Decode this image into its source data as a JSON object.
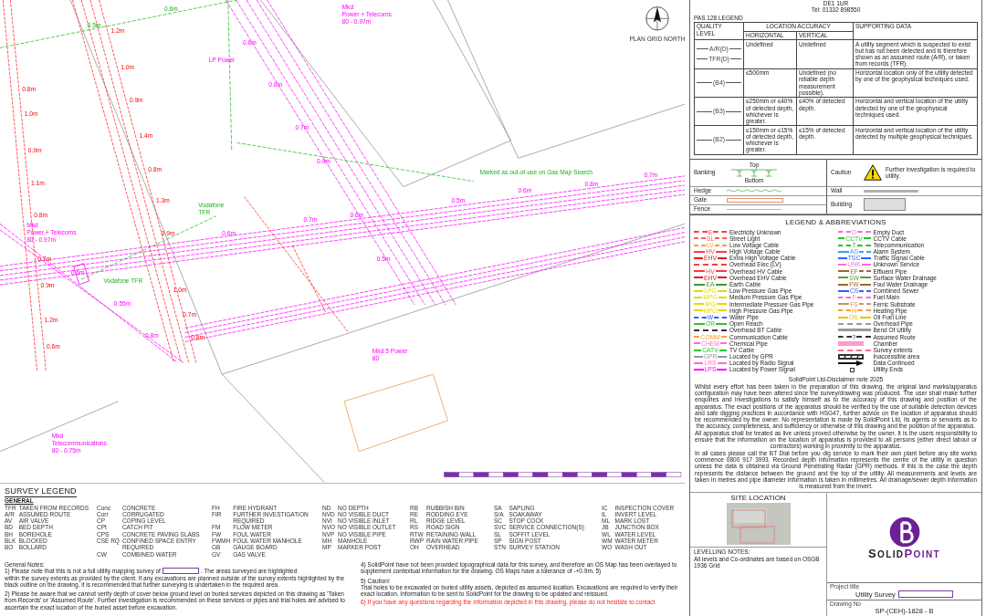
{
  "header": {
    "address_lines": [
      "DE1 1UR",
      "Tel: 01332 898550"
    ]
  },
  "map": {
    "north_label": "PLAN GRID NORTH",
    "notes": [
      {
        "lines": [
          "Mkd",
          "Power + Telecoms",
          "80 - 0.97m"
        ],
        "kind": "signal"
      },
      {
        "lines": [
          "LP Power"
        ],
        "kind": "signal"
      },
      {
        "lines": [
          "Mkd",
          "Power + Telecoms",
          "80 - 0.97m"
        ],
        "kind": "signal"
      },
      {
        "lines": [
          "Vodafone TFR"
        ],
        "kind": "records"
      },
      {
        "lines": [
          "Vodafone",
          "TFR"
        ],
        "kind": "records"
      },
      {
        "lines": [
          "Marked as out-of-use on Gas Map Search"
        ],
        "kind": "records"
      },
      {
        "lines": [
          "Mkd 5 Power",
          "80"
        ],
        "kind": "signal"
      },
      {
        "lines": [
          "Mkd",
          "Telecommunications",
          "80 - 0.75m"
        ],
        "kind": "signal"
      }
    ],
    "depths": [
      {
        "text": "0.8m",
        "kind": "electric"
      },
      {
        "text": "1.0m",
        "kind": "electric"
      },
      {
        "text": "0.9m",
        "kind": "electric"
      },
      {
        "text": "1.1m",
        "kind": "electric"
      },
      {
        "text": "0.8m",
        "kind": "electric"
      },
      {
        "text": "0.7m",
        "kind": "electric"
      },
      {
        "text": "0.9m",
        "kind": "electric"
      },
      {
        "text": "1.2m",
        "kind": "electric"
      },
      {
        "text": "0.6m",
        "kind": "electric"
      },
      {
        "text": "1.2m",
        "kind": "electric"
      },
      {
        "text": "1.0m",
        "kind": "electric"
      },
      {
        "text": "0.9m",
        "kind": "electric"
      },
      {
        "text": "1.4m",
        "kind": "electric"
      },
      {
        "text": "0.8m",
        "kind": "electric"
      },
      {
        "text": "1.3m",
        "kind": "electric"
      },
      {
        "text": "0.9m",
        "kind": "electric"
      },
      {
        "text": "1.0m",
        "kind": "electric"
      },
      {
        "text": "0.7m",
        "kind": "electric"
      },
      {
        "text": "0.8m",
        "kind": "electric"
      },
      {
        "text": "0.6m",
        "kind": "signal"
      },
      {
        "text": "0.8m",
        "kind": "signal"
      },
      {
        "text": "0.7m",
        "kind": "signal"
      },
      {
        "text": "0.9m",
        "kind": "signal"
      },
      {
        "text": "0.6m",
        "kind": "signal"
      },
      {
        "text": "0.5m",
        "kind": "signal"
      },
      {
        "text": "0.6m",
        "kind": "signal"
      },
      {
        "text": "0.7m",
        "kind": "signal"
      },
      {
        "text": "0.5m",
        "kind": "signal"
      },
      {
        "text": "0.6m",
        "kind": "signal"
      },
      {
        "text": "0.8m",
        "kind": "signal"
      },
      {
        "text": "0.7m",
        "kind": "signal"
      },
      {
        "text": "0.6m",
        "kind": "signal"
      },
      {
        "text": "0.55m",
        "kind": "signal"
      },
      {
        "text": "0.8m",
        "kind": "signal"
      },
      {
        "text": "0.5m",
        "kind": "records"
      },
      {
        "text": "0.6m",
        "kind": "records"
      }
    ]
  },
  "pas128": {
    "title": "PAS 128 LEGEND",
    "headers": {
      "quality": "QUALITY LEVEL",
      "accuracy": "LOCATION ACCURACY",
      "horizontal": "HORIZONTAL",
      "vertical": "VERTICAL",
      "supporting": "SUPPORTING DATA"
    },
    "rows": [
      {
        "codes": [
          "A/R(D)",
          "TFR(D)"
        ],
        "horizontal": "Undefined",
        "vertical": "Undefined",
        "supporting": "A utility segment which is suspected to exist but has not been detected and is therefore shown as an assumed route (A/R), or taken from records (TFR)."
      },
      {
        "codes": [
          "(B4)"
        ],
        "horizontal": "≤500mm",
        "vertical": "Undefined (no reliable depth measurement possible).",
        "supporting": "Horizontal location only of the utility detected by one of the geophysical techniques used."
      },
      {
        "codes": [
          "(B3)"
        ],
        "horizontal": "≤250mm or ≤40% of detected depth, whichever is greater.",
        "vertical": "≤40% of detected depth.",
        "supporting": "Horizontal and vertical location of the utility detected by one of the geophysical techniques used."
      },
      {
        "codes": [
          "(B2)"
        ],
        "horizontal": "≤150mm or ≤15% of detected depth, whichever is greater.",
        "vertical": "≤15% of detected depth.",
        "supporting": "Horizontal and vertical location of the utility detected by multiple geophysical techniques."
      }
    ]
  },
  "features": {
    "banking": {
      "label": "Banking",
      "top": "Top",
      "bottom": "Bottom"
    },
    "caution": {
      "label": "Caution",
      "text": "Further investigation is required to utility."
    },
    "items": [
      {
        "label": "Hedge",
        "kind": "hedge"
      },
      {
        "label": "Wall",
        "kind": "wall"
      },
      {
        "label": "Gate",
        "kind": "gate"
      },
      {
        "label": "Building",
        "kind": "building"
      },
      {
        "label": "Fence",
        "kind": "fence"
      }
    ]
  },
  "legend": {
    "title": "LEGEND & ABBREVIATIONS",
    "columns": [
      [
        {
          "code": "E",
          "label": "Electricity Unknown",
          "color": "#ff3b3b",
          "kind": "line"
        },
        {
          "code": "SL",
          "label": "Street Light",
          "color": "#ff5a5a",
          "kind": "line"
        },
        {
          "code": "LV",
          "label": "Low Voltage Cable",
          "color": "#ff9b30",
          "kind": "line"
        },
        {
          "code": "HV",
          "label": "High Voltage Cable",
          "color": "#ff3b3b",
          "kind": "line"
        },
        {
          "code": "EHV",
          "label": "Extra High Voltage Cable",
          "color": "#d81b1b",
          "kind": "line"
        },
        {
          "label": "Overhead Elec (LV)",
          "color": "#ff3b3b",
          "kind": "line"
        },
        {
          "code": "HV",
          "label": "Overhead HV Cable",
          "color": "#ff3b3b",
          "kind": "line"
        },
        {
          "code": "EHV",
          "label": "Overhead EHV Cable",
          "color": "#d81b1b",
          "kind": "line"
        },
        {
          "code": "EA",
          "label": "Earth Cable",
          "color": "#3a9a3a",
          "kind": "line"
        },
        {
          "code": "LPG",
          "label": "Low Pressure Gas Pipe",
          "color": "#e6d800",
          "kind": "line"
        },
        {
          "code": "MPG",
          "label": "Medium Pressure Gas Pipe",
          "color": "#e6d800",
          "kind": "line"
        },
        {
          "code": "IPG",
          "label": "Intermediate Pressure Gas Pipe",
          "color": "#e6d800",
          "kind": "line"
        },
        {
          "code": "HPG",
          "label": "High Pressure Gas Pipe",
          "color": "#e6d800",
          "kind": "line"
        },
        {
          "code": "W",
          "label": "Water Pipe",
          "color": "#3060ff",
          "kind": "line"
        },
        {
          "code": "OR",
          "label": "Open Reach",
          "color": "#2fbf2f",
          "kind": "line"
        },
        {
          "label": "Overhead BT Cable",
          "color": "#333333",
          "kind": "line"
        },
        {
          "code": "COMM",
          "label": "Communication Cable",
          "color": "#ff9b30",
          "kind": "line"
        },
        {
          "code": "CHEM",
          "label": "Chemical Pipe",
          "color": "#ff6ad5",
          "kind": "line"
        },
        {
          "code": "CATV",
          "label": "TV Cable",
          "color": "#2fbf2f",
          "kind": "line"
        },
        {
          "code": "GPR",
          "label": "Located by GPR",
          "color": "#9a9a9a",
          "kind": "line"
        },
        {
          "code": "LRS",
          "label": "Located by Radio Signal",
          "color": "#ff6ad5",
          "kind": "line"
        },
        {
          "code": "LPS",
          "label": "Located by Power Signal",
          "color": "#ff00ff",
          "kind": "line"
        }
      ],
      [
        {
          "code": "D",
          "label": "Empty Duct",
          "color": "#ff6ad5",
          "kind": "line"
        },
        {
          "code": "CCTV",
          "label": "CCTV Cable",
          "color": "#2fbf2f",
          "kind": "line"
        },
        {
          "code": "T",
          "label": "Telecommunication",
          "color": "#2fbf2f",
          "kind": "line"
        },
        {
          "code": "AS",
          "label": "Alarm System",
          "color": "#30a0ff",
          "kind": "line"
        },
        {
          "code": "TSC",
          "label": "Traffic Signal Cable",
          "color": "#3060ff",
          "kind": "line"
        },
        {
          "code": "UNK",
          "label": "Unknown Service",
          "color": "#ff6ad5",
          "kind": "line"
        },
        {
          "code": "EF",
          "label": "Effluent Pipe",
          "color": "#a0662a",
          "kind": "line"
        },
        {
          "code": "SW",
          "label": "Surface Water Drainage",
          "color": "#5f9f2f",
          "kind": "line"
        },
        {
          "code": "FW",
          "label": "Foul Water Drainage",
          "color": "#a0662a",
          "kind": "line"
        },
        {
          "code": "CS",
          "label": "Combined Sewer",
          "color": "#3060ff",
          "kind": "line"
        },
        {
          "code": "F",
          "label": "Fuel Main",
          "color": "#ff6ad5",
          "kind": "line"
        },
        {
          "code": "FS",
          "label": "Ferric Substrate",
          "color": "#c8965a",
          "kind": "line"
        },
        {
          "code": "H",
          "label": "Heating Pipe",
          "color": "#ff9b30",
          "kind": "line"
        },
        {
          "code": "OIL",
          "label": "Oil Fuel Line",
          "color": "#e6c200",
          "kind": "line"
        },
        {
          "label": "Overhead Pipe",
          "color": "#9a9a9a",
          "kind": "line"
        },
        {
          "label": "Bend Of Utility",
          "color": "#9a9a9a",
          "kind": "bar"
        },
        {
          "code": "?",
          "label": "Assumed Route",
          "color": "#333333",
          "kind": "line"
        },
        {
          "label": "Chamber",
          "color": "#ff99cc",
          "kind": "box"
        },
        {
          "label": "Survey extents",
          "color": "#ff6a8a",
          "kind": "line"
        },
        {
          "label": "Inaccessible area",
          "color": "#333333",
          "kind": "hatch"
        },
        {
          "label": "Data Continued",
          "color": "#111111",
          "kind": "arrow"
        },
        {
          "label": "Utility Ends",
          "color": "#333333",
          "kind": "end"
        }
      ]
    ]
  },
  "disclaimer": {
    "title": "SolidPoint Ltd-Disclaimer note 2025",
    "paragraphs": [
      "Whilst every effort has been taken in the preparation of this drawing, the original land marks/apparatus configuration may have been altered since the survey/drawing was produced. The user shall make further enquiries and investigations to satisfy himself as to the accuracy of this drawing and position of the apparatus. The exact positions of the apparatus should be verified by the use of suitable detection devices and safe digging practices in accordance with HSG47, further advice on the location of apparatus should be recommended by the owner. No representation is made by SolidPoint Ltd, its agents or servants as to the accuracy, completeness, and sufficiency or otherwise of this drawing and the position of the apparatus.",
      "All apparatus shall be treated as live unless proved otherwise by the owner. It is the users responsibility to ensure that the information on the location of apparatus is provided to all persons (either direct labour or contractors) working in proximity to the apparatus.",
      "In all cases please call the BT Dial before you dig service to mark their own plant before any site works commence 0800 917 3993. Recorded depth information represents the centre of the utility in question unless the data is obtained via Ground Penetrating Radar (GPR) methods. If this is the case the depth represents the distance between the ground and the top of the utility. All measurements and levels are taken in metres and pipe diameter information is taken in millimetres. All drainage/sewer depth information is measured from the invert."
    ]
  },
  "site_location": {
    "title": "SITE LOCATION"
  },
  "levelling": {
    "title": "LEVELLING NOTES:",
    "text": "All levels and Co-ordinates are based on OSGB 1936 Grid"
  },
  "title_block": {
    "logo": {
      "word_1": "SOLID",
      "word_2": "POINT"
    },
    "project_label": "Project title",
    "project": "Utility Survey",
    "drawing_label": "Drawing No",
    "drawing_no": "SP-(CEH)-1828 - B"
  },
  "survey_legend": {
    "title": "SURVEY LEGEND",
    "subtitle": "GENERAL",
    "columns": [
      [
        {
          "code": "TFR",
          "meaning": "TAKEN FROM RECORDS"
        },
        {
          "code": "A/R",
          "meaning": "ASSUMED ROUTE"
        },
        {
          "code": "AV",
          "meaning": "AIR VALVE"
        },
        {
          "code": "BD",
          "meaning": "BED DEPTH"
        },
        {
          "code": "BH",
          "meaning": "BOREHOLE"
        },
        {
          "code": "BLK",
          "meaning": "BLOCKED"
        },
        {
          "code": "BO",
          "meaning": "BOLLARD"
        }
      ],
      [
        {
          "code": "Conc",
          "meaning": "CONCRETE"
        },
        {
          "code": "Corr",
          "meaning": "CORRUGATED"
        },
        {
          "code": "CP",
          "meaning": "COPING LEVEL"
        },
        {
          "code": "CPt",
          "meaning": "CATCH PIT"
        },
        {
          "code": "CPS",
          "meaning": "CONCRETE PAVING SLABS"
        },
        {
          "code": "CSE RQ",
          "meaning": "CONFINED SPACE ENTRY REQUIRED"
        },
        {
          "code": "CW",
          "meaning": "COMBINED WATER"
        }
      ],
      [
        {
          "code": "FH",
          "meaning": "FIRE HYDRANT"
        },
        {
          "code": "FIR",
          "meaning": "FURTHER INVESTIGATION REQUIRED"
        },
        {
          "code": "FM",
          "meaning": "FLOW METER"
        },
        {
          "code": "FW",
          "meaning": "FOUL WATER"
        },
        {
          "code": "FWMH",
          "meaning": "FOUL WATER MANHOLE"
        },
        {
          "code": "GB",
          "meaning": "GAUGE BOARD"
        },
        {
          "code": "GV",
          "meaning": "GAS VALVE"
        }
      ],
      [
        {
          "code": "ND",
          "meaning": "NO DEPTH"
        },
        {
          "code": "NVD",
          "meaning": "NO VISIBLE DUCT"
        },
        {
          "code": "NVI",
          "meaning": "NO VISIBLE INLET"
        },
        {
          "code": "NVO",
          "meaning": "NO VISIBLE OUTLET"
        },
        {
          "code": "NVP",
          "meaning": "NO VISIBLE PIPE"
        },
        {
          "code": "MH",
          "meaning": "MANHOLE"
        },
        {
          "code": "MP",
          "meaning": "MARKER POST"
        }
      ],
      [
        {
          "code": "RB",
          "meaning": "RUBBISH BIN"
        },
        {
          "code": "RE",
          "meaning": "RODDING EYE"
        },
        {
          "code": "RL",
          "meaning": "RIDGE LEVEL"
        },
        {
          "code": "RS",
          "meaning": "ROAD SIGN"
        },
        {
          "code": "RTW",
          "meaning": "RETAINING WALL"
        },
        {
          "code": "RWP",
          "meaning": "RAIN WATER PIPE"
        },
        {
          "code": "OH",
          "meaning": "OVERHEAD"
        }
      ],
      [
        {
          "code": "SA",
          "meaning": "SAPLING"
        },
        {
          "code": "S/A",
          "meaning": "SOAKAWAY"
        },
        {
          "code": "SC",
          "meaning": "STOP COCK"
        },
        {
          "code": "SVC",
          "meaning": "SERVICE CONNECTION(S)"
        },
        {
          "code": "SL",
          "meaning": "SOFFIT LEVEL"
        },
        {
          "code": "SP",
          "meaning": "SIGN POST"
        },
        {
          "code": "STN",
          "meaning": "SURVEY STATION"
        }
      ],
      [
        {
          "code": "IC",
          "meaning": "INSPECTION COVER"
        },
        {
          "code": "IL",
          "meaning": "INVERT LEVEL"
        },
        {
          "code": "ML",
          "meaning": "MARK LOST"
        },
        {
          "code": "JB",
          "meaning": "JUNCTION BOX"
        },
        {
          "code": "WL",
          "meaning": "WATER LEVEL"
        },
        {
          "code": "WM",
          "meaning": "WATER METER"
        },
        {
          "code": "WO",
          "meaning": "WASH OUT"
        }
      ]
    ]
  },
  "general_notes": {
    "title": "General Notes:",
    "columns": [
      [
        {
          "kind": "redacted",
          "parts": [
            "1) Please note that this is not a full utility mapping survey of",
            ". The areas surveyed are highlighted",
            "within the survey extents as provided by the client. If any excavations are planned outside of the survey extents highlighted by the black outline on the drawing, it is recommended that further surveying is undertaken in the required area."
          ]
        },
        {
          "kind": "plain",
          "text": "2) Please be aware that we cannot verify depth of cover below ground level on buried services depicted on this drawing as 'Taken from Records' or 'Assumed Route'. Further investigation is recommended on these services or pipes and trial holes are advised to ascertain the exact location of the buried asset before excavation."
        }
      ],
      [
        {
          "kind": "plain",
          "text": "4) SolidPoint have not been provided topographical data for this survey, and therefore an OS Map has been overlayed to supplement contextual information for the drawing. OS Maps have a tolerance of -+0.9m. 5)"
        },
        {
          "kind": "heading",
          "text": "5) Caution!"
        },
        {
          "kind": "tight",
          "text": "Trial holes to be excavated on buried utility assets, depicted as assumed location. Excavations are required to verify their exact location. Information to be sent to SolidPoint for the drawing to be updated and reissued."
        },
        {
          "kind": "warning",
          "text": "6) If you have any questions regarding the information depicted in this drawing, please do not hesitate to contact"
        }
      ]
    ]
  }
}
